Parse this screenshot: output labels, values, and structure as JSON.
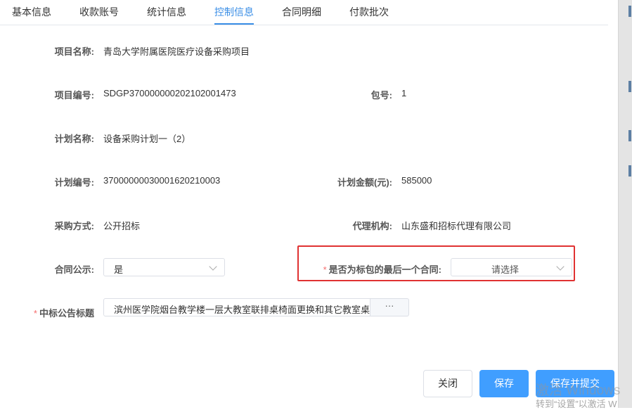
{
  "tabs": [
    {
      "label": "基本信息"
    },
    {
      "label": "收款账号"
    },
    {
      "label": "统计信息"
    },
    {
      "label": "控制信息"
    },
    {
      "label": "合同明细"
    },
    {
      "label": "付款批次"
    }
  ],
  "active_tab": "控制信息",
  "form": {
    "project_name": {
      "label": "项目名称:",
      "value": "青岛大学附属医院医疗设备采购项目"
    },
    "project_no": {
      "label": "项目编号:",
      "value": "SDGP370000000202102001473"
    },
    "package_no": {
      "label": "包号:",
      "value": "1"
    },
    "plan_name": {
      "label": "计划名称:",
      "value": "设备采购计划一（2）"
    },
    "plan_no": {
      "label": "计划编号:",
      "value": "37000000030001620210003"
    },
    "plan_amount": {
      "label": "计划金额(元):",
      "value": "585000"
    },
    "purchase_method": {
      "label": "采购方式:",
      "value": "公开招标"
    },
    "agency": {
      "label": "代理机构:",
      "value": "山东盛和招标代理有限公司"
    },
    "contract_public": {
      "label": "合同公示:",
      "value": "是"
    },
    "last_contract": {
      "required_mark": "*",
      "label": "是否为标包的最后一个合同:",
      "placeholder": "请选择"
    },
    "bid_notice_title": {
      "required_mark": "*",
      "label": "中标公告标题",
      "value": "滨州医学院烟台教学楼一层大教室联排桌椅面更换和其它教室桌椅",
      "button": "···"
    }
  },
  "buttons": {
    "close": "关闭",
    "save": "保存",
    "save_submit": "保存并提交"
  },
  "watermark": {
    "line1": "激活 Windows",
    "line2": "转到“设置”以激活 W"
  },
  "colors": {
    "accent": "#409eff",
    "highlight_border": "#e03232",
    "required": "#f56c6c"
  }
}
